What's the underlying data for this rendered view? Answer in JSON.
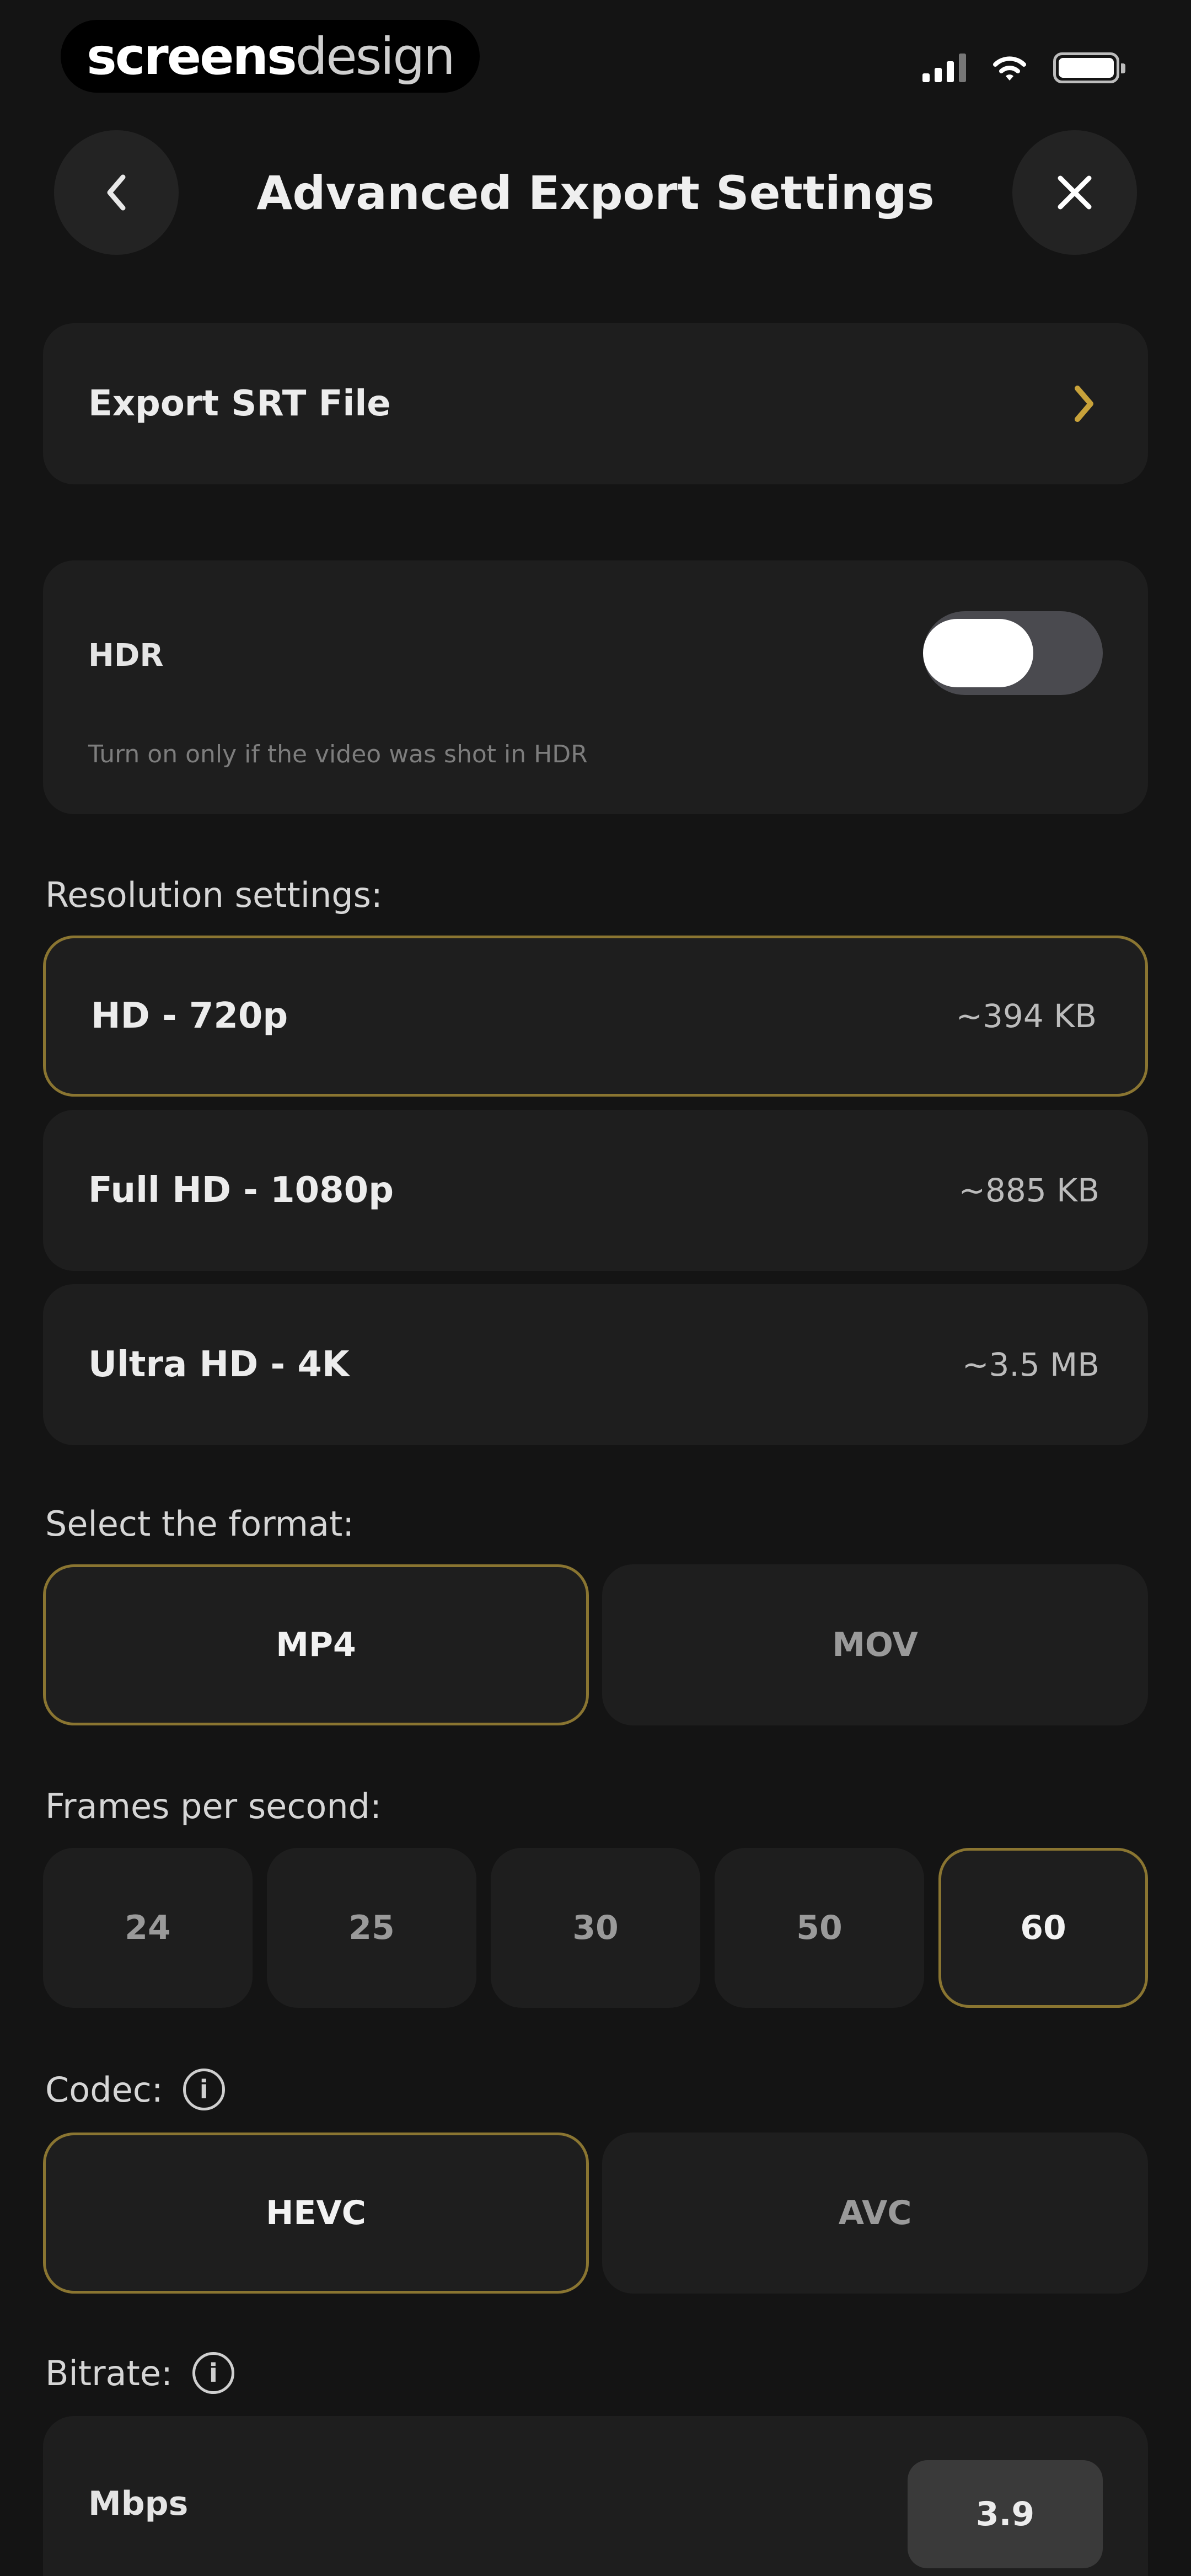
{
  "watermark": {
    "bold": "screens",
    "light": "design"
  },
  "header": {
    "title": "Advanced Export Settings"
  },
  "srt": {
    "label": "Export SRT File"
  },
  "hdr": {
    "label": "HDR",
    "description": "Turn on only if the video was shot in HDR",
    "enabled": true
  },
  "resolution": {
    "label": "Resolution settings:",
    "options": [
      {
        "label": "HD - 720p",
        "size": "~394 KB",
        "selected": true
      },
      {
        "label": "Full HD - 1080p",
        "size": "~885 KB",
        "selected": false
      },
      {
        "label": "Ultra HD - 4K",
        "size": "~3.5 MB",
        "selected": false
      }
    ]
  },
  "format": {
    "label": "Select the format:",
    "options": [
      {
        "label": "MP4",
        "selected": true
      },
      {
        "label": "MOV",
        "selected": false
      }
    ]
  },
  "fps": {
    "label": "Frames per second:",
    "options": [
      {
        "label": "24",
        "selected": false
      },
      {
        "label": "25",
        "selected": false
      },
      {
        "label": "30",
        "selected": false
      },
      {
        "label": "50",
        "selected": false
      },
      {
        "label": "60",
        "selected": true
      }
    ]
  },
  "codec": {
    "label": "Codec:",
    "options": [
      {
        "label": "HEVC",
        "selected": true
      },
      {
        "label": "AVC",
        "selected": false
      }
    ]
  },
  "bitrate": {
    "label": "Bitrate:",
    "unit": "Mbps",
    "value": "3.9"
  },
  "colors": {
    "background": "#141414",
    "card": "#1e1e1e",
    "accent": "#8a7531",
    "chevron": "#c8a23a"
  }
}
